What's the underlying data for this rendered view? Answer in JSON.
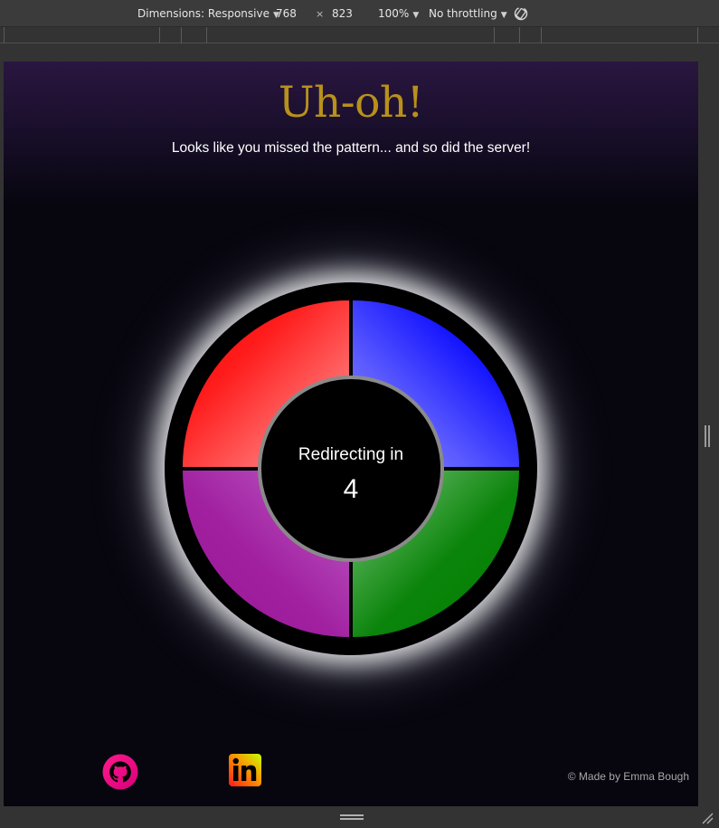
{
  "devtools": {
    "dimensions_label": "Dimensions: Responsive",
    "width": "768",
    "times": "×",
    "height": "823",
    "zoom": "100%",
    "throttling": "No throttling",
    "rotate_icon": "rotate-icon"
  },
  "page": {
    "title": "Uh-oh!",
    "subtitle": "Looks like you missed the pattern... and so did the server!",
    "redirect_label": "Redirecting in",
    "countdown": "4",
    "credit": "© Made by Emma Bough"
  },
  "board": {
    "colors": {
      "red": "#ff0000",
      "blue": "#0000ff",
      "purple": "#a020a0",
      "green": "#008000",
      "ring": "#000000",
      "center_border": "#8a8a8a"
    }
  },
  "social": {
    "github_icon": "github-icon",
    "linkedin_icon": "linkedin-icon"
  },
  "theme": {
    "title_color": "#b8911b",
    "background": "#07060f",
    "header_top": "#2a1640"
  }
}
